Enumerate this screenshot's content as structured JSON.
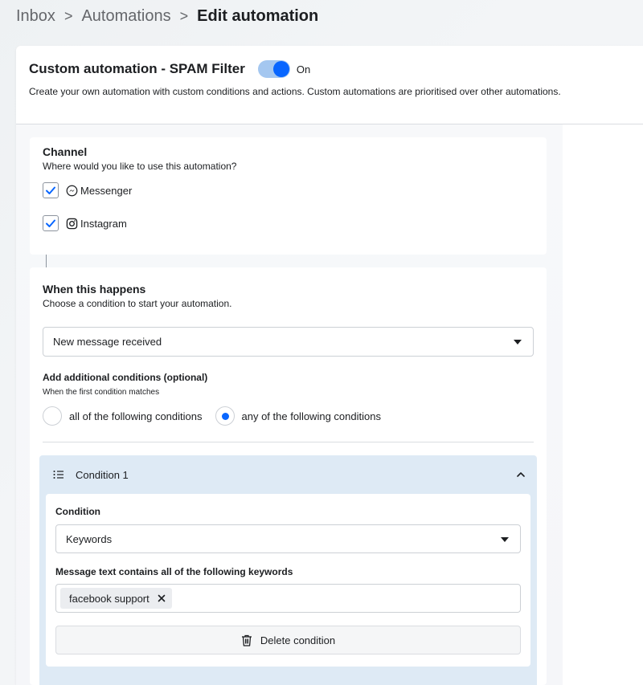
{
  "breadcrumb": {
    "items": [
      "Inbox",
      "Automations"
    ],
    "separator": ">",
    "current": "Edit automation"
  },
  "automation": {
    "title": "Custom automation - SPAM Filter",
    "enabled": true,
    "toggle_label": "On",
    "description": "Create your own automation with custom conditions and actions. Custom automations are prioritised over other automations."
  },
  "channel": {
    "title": "Channel",
    "description": "Where would you like to use this automation?",
    "options": [
      {
        "label": "Messenger",
        "checked": true,
        "icon": "messenger-icon"
      },
      {
        "label": "Instagram",
        "checked": true,
        "icon": "instagram-icon"
      }
    ]
  },
  "trigger": {
    "title": "When this happens",
    "description": "Choose a condition to start your automation.",
    "selected": "New message received",
    "additional_title": "Add additional conditions (optional)",
    "additional_desc": "When the first condition matches",
    "match_options": [
      {
        "label": "all of the following conditions",
        "selected": false
      },
      {
        "label": "any of the following conditions",
        "selected": true
      }
    ]
  },
  "condition_1": {
    "name": "Condition 1",
    "condition_label": "Condition",
    "condition_value": "Keywords",
    "keywords_label": "Message text contains all of the following keywords",
    "keywords": [
      "facebook support"
    ],
    "delete_label": "Delete condition"
  },
  "colors": {
    "accent": "#0866ff",
    "toggle_track": "#a4c7f0",
    "condition_panel": "#deeaf5"
  }
}
